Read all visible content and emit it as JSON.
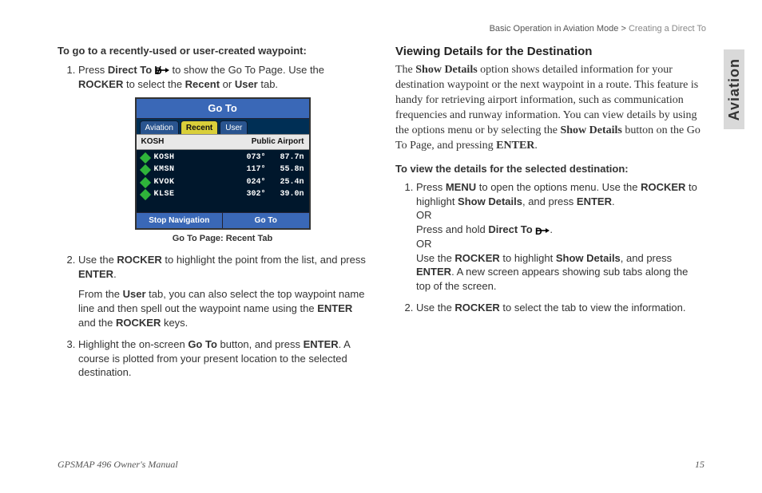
{
  "breadcrumb": {
    "main": "Basic Operation in Aviation Mode",
    "sep": ">",
    "sub": "Creating a Direct To"
  },
  "sideTab": "Aviation",
  "left": {
    "heading": "To go to a recently-used or user-created waypoint:",
    "step1_a": "Press ",
    "step1_b": "Direct To",
    "step1_c": " to show the Go To Page. Use the ",
    "step1_d": "ROCKER",
    "step1_e": " to select the ",
    "step1_f": "Recent",
    "step1_g": " or ",
    "step1_h": "User",
    "step1_i": " tab.",
    "step2_a": "Use the ",
    "step2_b": "ROCKER",
    "step2_c": " to highlight the point from the list, and press ",
    "step2_d": "ENTER",
    "step2_e": ".",
    "step2_note_a": "From the ",
    "step2_note_b": "User",
    "step2_note_c": " tab, you can also select the top waypoint name line and then spell out the waypoint name using the ",
    "step2_note_d": "ENTER",
    "step2_note_e": " and the ",
    "step2_note_f": "ROCKER",
    "step2_note_g": " keys.",
    "step3_a": "Highlight the on-screen ",
    "step3_b": "Go To",
    "step3_c": " button, and press ",
    "step3_d": "ENTER",
    "step3_e": ". A course is plotted from your present location to the selected destination.",
    "caption": "Go To Page: Recent Tab"
  },
  "device": {
    "title": "Go To",
    "tabs": [
      "Aviation",
      "Recent",
      "User"
    ],
    "activeTab": "Recent",
    "subheadLeft": "KOSH",
    "subheadRight": "Public Airport",
    "rows": [
      {
        "ident": "KOSH",
        "brg": "073°",
        "dist": "87.7n"
      },
      {
        "ident": "KMSN",
        "brg": "117°",
        "dist": "55.8n"
      },
      {
        "ident": "KVOK",
        "brg": "024°",
        "dist": "25.4n"
      },
      {
        "ident": "KLSE",
        "brg": "302°",
        "dist": "39.0n"
      }
    ],
    "buttons": [
      "Stop Navigation",
      "Go To"
    ]
  },
  "right": {
    "section": "Viewing Details for the Destination",
    "para_a": "The ",
    "para_b": "Show Details",
    "para_c": " option shows detailed information for your destination waypoint or the next waypoint in a route. This feature is handy for retrieving airport information, such as communication frequencies and runway information. You can view details by using the options menu or by selecting the ",
    "para_d": "Show Details",
    "para_e": " button on the Go To Page, and pressing ",
    "para_f": "ENTER",
    "para_g": ".",
    "heading2": "To view the details for the selected destination:",
    "r1_a": "Press ",
    "r1_b": "MENU",
    "r1_c": " to open the options menu. Use the ",
    "r1_d": "ROCKER",
    "r1_e": " to highlight ",
    "r1_f": "Show Details",
    "r1_g": ", and press ",
    "r1_h": "ENTER",
    "r1_i": ".",
    "r1_or": "OR",
    "r1_j": "Press and hold ",
    "r1_k": "Direct To",
    "r1_l": ".",
    "r1_or2": "OR",
    "r1_m": "Use the ",
    "r1_n": "ROCKER",
    "r1_o": " to highlight ",
    "r1_p": "Show Details",
    "r1_q": ", and press ",
    "r1_r": "ENTER",
    "r1_s": ". A new screen appears showing sub tabs along the top of the screen.",
    "r2_a": "Use the ",
    "r2_b": "ROCKER",
    "r2_c": " to select the tab to view the information."
  },
  "footer": {
    "left": "GPSMAP 496 Owner's Manual",
    "right": "15"
  }
}
